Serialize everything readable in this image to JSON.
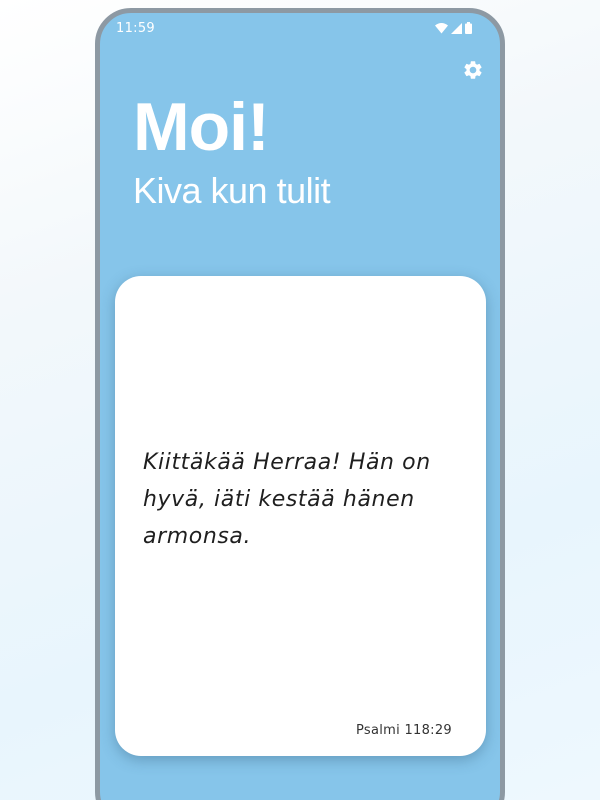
{
  "status_bar": {
    "time": "11:59",
    "icons": [
      "wifi-icon",
      "signal-icon",
      "battery-icon"
    ]
  },
  "header": {
    "settings_icon": "gear-icon",
    "title": "Moi!",
    "subtitle": "Kiva kun tulit"
  },
  "verse_card": {
    "text": "Kiittäkää Herraa! Hän on hyvä, iäti kestää hänen armonsa.",
    "reference": "Psalmi 118:29"
  },
  "colors": {
    "app_background": "#86c5ea",
    "card_background": "#ffffff",
    "header_text": "#ffffff",
    "verse_text": "#1f1f1f"
  }
}
